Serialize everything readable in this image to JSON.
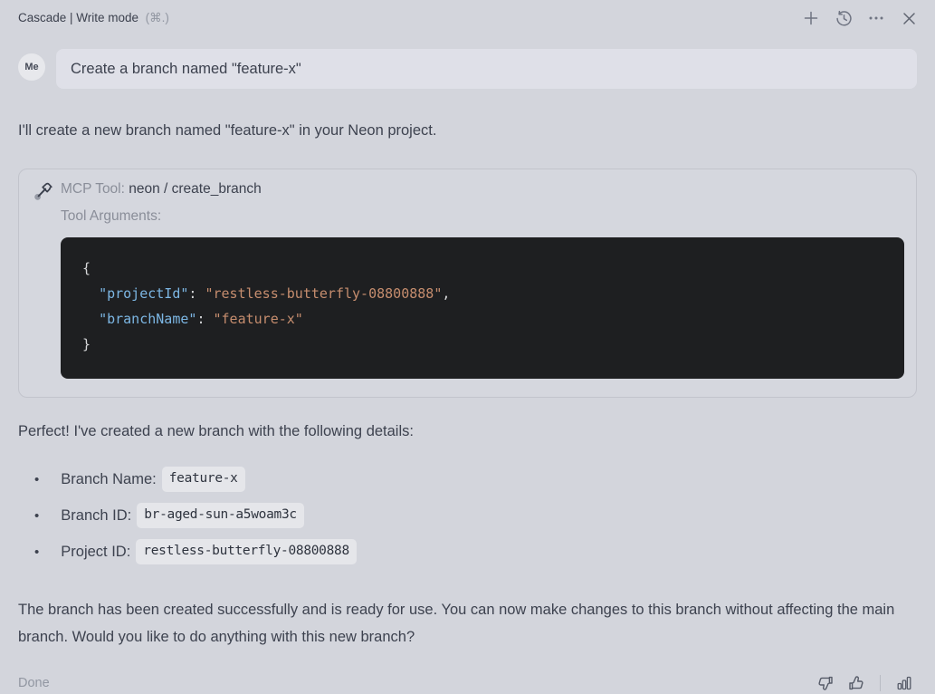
{
  "header": {
    "title": "Cascade | Write mode",
    "shortcut": "(⌘.)",
    "actions": [
      "new-conversation",
      "history",
      "more-options",
      "close"
    ]
  },
  "user_message": {
    "avatar_label": "Me",
    "text": "Create a branch named \"feature-x\""
  },
  "assistant": {
    "intro": "I'll create a new branch named \"feature-x\" in your Neon project.",
    "tool_card": {
      "label": "MCP Tool: ",
      "tool_name": "neon / create_branch",
      "arguments_label": "Tool Arguments:",
      "code_tokens": [
        {
          "text": "{\n  ",
          "type": "punct"
        },
        {
          "text": "\"projectId\"",
          "type": "key"
        },
        {
          "text": ": ",
          "type": "punct"
        },
        {
          "text": "\"restless-butterfly-08800888\"",
          "type": "string"
        },
        {
          "text": ",\n  ",
          "type": "punct"
        },
        {
          "text": "\"branchName\"",
          "type": "key"
        },
        {
          "text": ": ",
          "type": "punct"
        },
        {
          "text": "\"feature-x\"",
          "type": "string"
        },
        {
          "text": "\n}",
          "type": "punct"
        }
      ]
    },
    "result_intro": "Perfect! I've created a new branch with the following details:",
    "bullet_char": "•",
    "details": [
      {
        "label": "Branch Name:",
        "value": "feature-x"
      },
      {
        "label": "Branch ID:",
        "value": "br-aged-sun-a5woam3c"
      },
      {
        "label": "Project ID:",
        "value": "restless-butterfly-08800888"
      }
    ],
    "closing": "The branch has been created successfully and is ready for use. You can now make changes to this branch without affecting the main branch. Would you like to do anything with this new branch?"
  },
  "footer": {
    "status": "Done"
  },
  "colors": {
    "page_bg": "#d3d5dc",
    "bubble_bg": "#dfe0e8",
    "code_bg": "#1e1f21",
    "code_key": "#7cb6e3",
    "code_string": "#c68d6e",
    "code_punct": "#d6d7d9",
    "muted_text": "#8a8e99",
    "body_text": "#3d424f"
  }
}
